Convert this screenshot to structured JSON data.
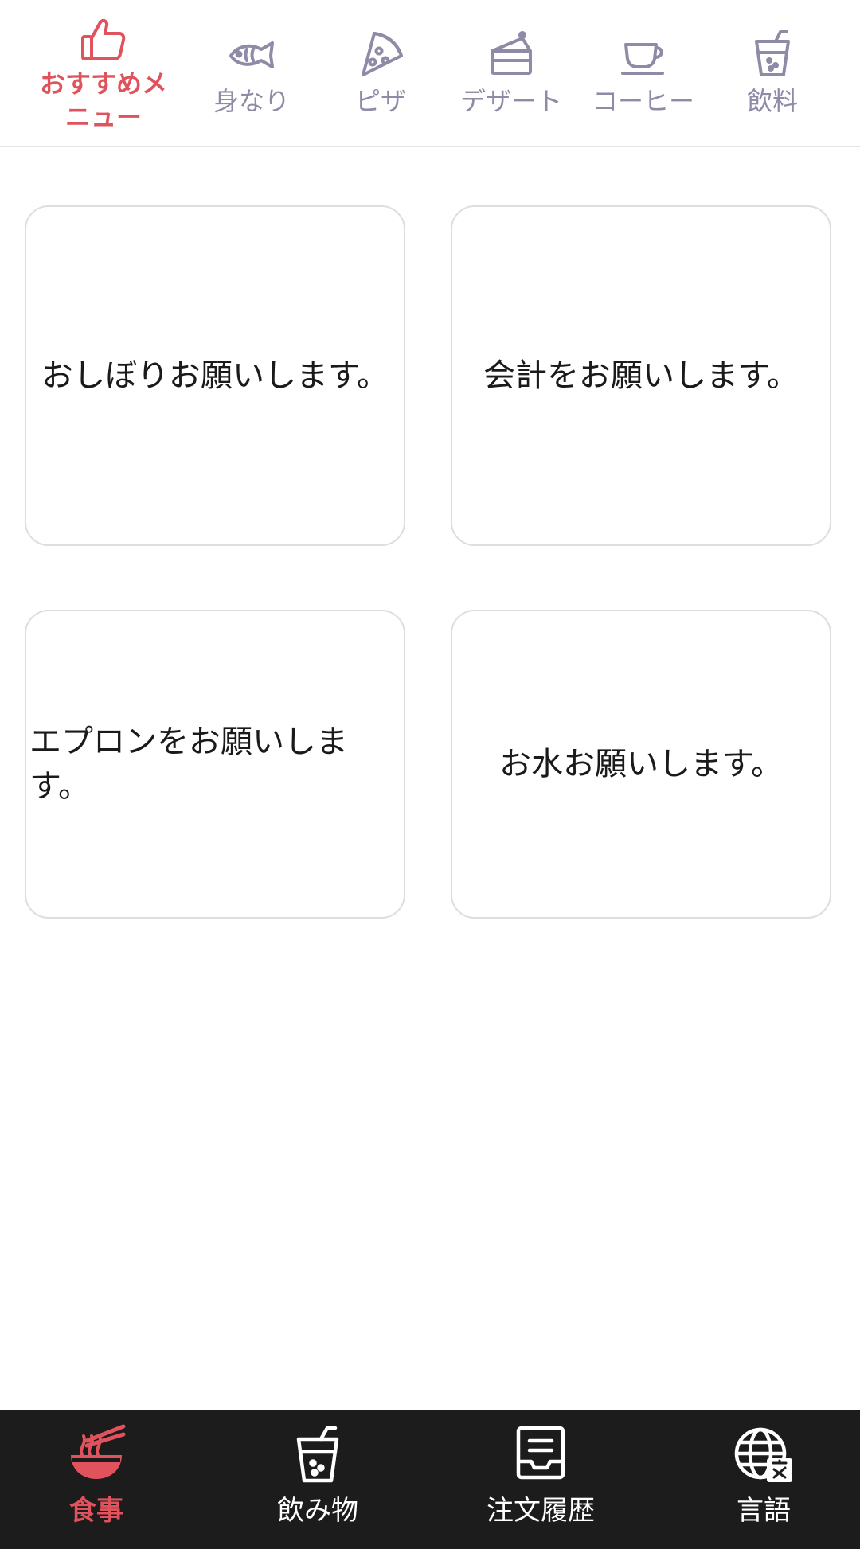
{
  "colors": {
    "accent": "#e0525c",
    "category_inactive": "#8f8aa6",
    "nav_background": "#1c1c1d",
    "card_border": "#dedede"
  },
  "categories": [
    {
      "label": "おすすめメニュー",
      "icon": "thumbs-up-icon",
      "active": true
    },
    {
      "label": "身なり",
      "icon": "fish-icon",
      "active": false
    },
    {
      "label": "ピザ",
      "icon": "pizza-icon",
      "active": false
    },
    {
      "label": "デザート",
      "icon": "cake-icon",
      "active": false
    },
    {
      "label": "コーヒー",
      "icon": "coffee-cup-icon",
      "active": false
    },
    {
      "label": "飲料",
      "icon": "drink-cup-icon",
      "active": false
    }
  ],
  "requests": [
    {
      "text": "おしぼりお願いします。"
    },
    {
      "text": "会計をお願いします。"
    },
    {
      "text": "エプロンをお願いします。"
    },
    {
      "text": "お水お願いします。"
    }
  ],
  "bottom_nav": [
    {
      "label": "食事",
      "icon": "noodle-bowl-icon",
      "active": true
    },
    {
      "label": "飲み物",
      "icon": "drink-cup-icon",
      "active": false
    },
    {
      "label": "注文履歴",
      "icon": "order-history-icon",
      "active": false
    },
    {
      "label": "言語",
      "icon": "language-globe-icon",
      "active": false
    }
  ]
}
